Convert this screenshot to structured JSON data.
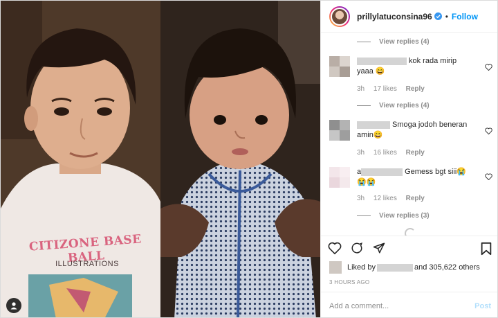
{
  "header": {
    "username": "prillylatuconsina96",
    "separator": "•",
    "follow_label": "Follow"
  },
  "photo": {
    "left_shirt_text": "CITIZONE BASE BALL",
    "left_shirt_subtext": "ILLUSTRATIONS"
  },
  "comments": {
    "view_replies_1": "View replies (4)",
    "view_replies_2": "View replies (4)",
    "view_replies_3": "View replies (3)",
    "items": [
      {
        "text": "kok rada mirip yaaa 😄",
        "time": "3h",
        "likes": "17 likes",
        "reply": "Reply"
      },
      {
        "text": "Smoga jodoh beneran amin😄",
        "time": "3h",
        "likes": "16 likes",
        "reply": "Reply"
      },
      {
        "text": "Gemess bgt siii😭😭😭",
        "prefix": "a",
        "time": "3h",
        "likes": "12 likes",
        "reply": "Reply"
      }
    ]
  },
  "footer": {
    "liked_by": "Liked by",
    "and_others": "and 305,622 others",
    "timestamp": "3 HOURS AGO",
    "comment_placeholder": "Add a comment...",
    "post_label": "Post"
  },
  "colors": {
    "accent": "#0095f6",
    "post_disabled": "#b2dffc",
    "muted": "#8e8e8e"
  }
}
